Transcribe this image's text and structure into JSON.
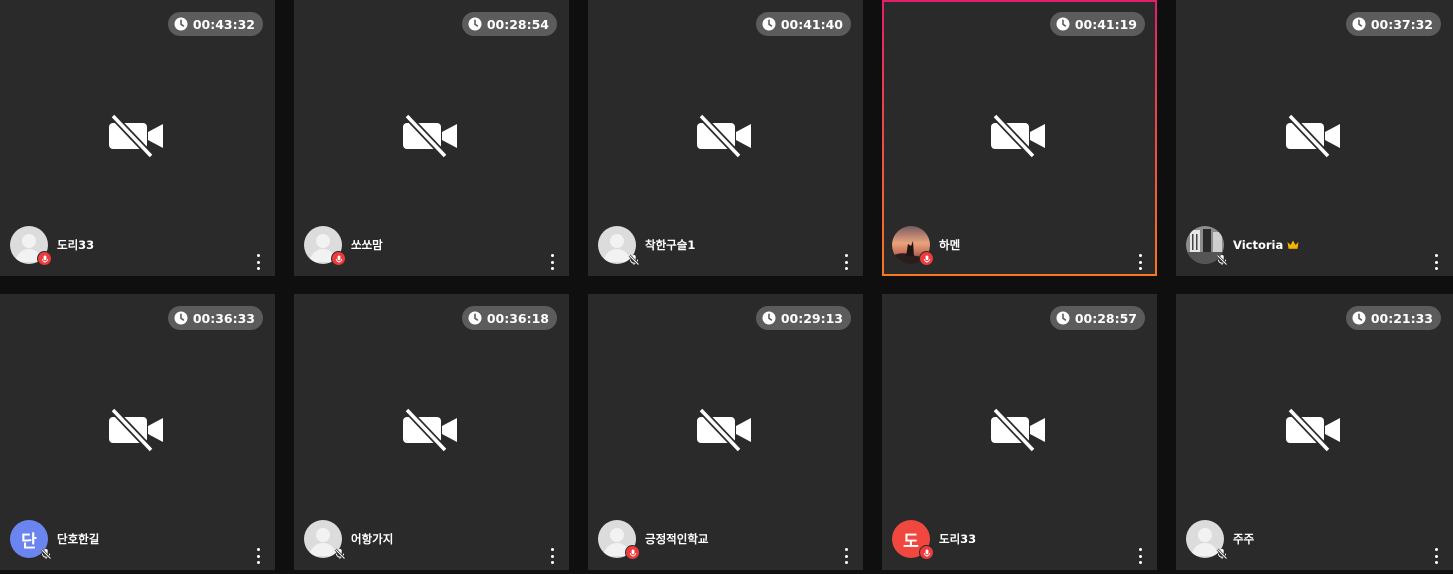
{
  "colors": {
    "page_background": "#0f0f0f",
    "tile_background": "#2a2a2a",
    "timer_background": "#5c5c5c",
    "active_border_start": "#e21f6b",
    "active_border_end": "#f4791f",
    "mic_on_badge": "#ef3b3b"
  },
  "tiles": [
    {
      "timer": "00:43:32",
      "name": "도리33",
      "avatar": "default",
      "mic": "on"
    },
    {
      "timer": "00:28:54",
      "name": "쏘쏘맘",
      "avatar": "default",
      "mic": "on"
    },
    {
      "timer": "00:41:40",
      "name": "착한구슬1",
      "avatar": "default",
      "mic": "off"
    },
    {
      "timer": "00:41:19",
      "name": "하멘",
      "avatar": "photo-sunset",
      "mic": "on",
      "active": true
    },
    {
      "timer": "00:37:32",
      "name": "Victoria",
      "avatar": "photo-room",
      "mic": "off",
      "crown": true
    },
    {
      "timer": "00:36:33",
      "name": "단호한길",
      "avatar": "initial",
      "initial": "단",
      "avatar_color": "#6b85f0",
      "mic": "off"
    },
    {
      "timer": "00:36:18",
      "name": "어항가지",
      "avatar": "default",
      "mic": "off"
    },
    {
      "timer": "00:29:13",
      "name": "긍정적인학교",
      "avatar": "default",
      "mic": "on"
    },
    {
      "timer": "00:28:57",
      "name": "도리33",
      "avatar": "initial",
      "initial": "도",
      "avatar_color": "#f0473f",
      "mic": "on"
    },
    {
      "timer": "00:21:33",
      "name": "주주",
      "avatar": "default",
      "mic": "off"
    }
  ],
  "icons": {
    "timer": "clock-icon",
    "camera": "video-off-icon",
    "menu": "more-vertical-icon",
    "mic_on": "microphone-icon",
    "mic_off": "microphone-muted-icon",
    "crown": "crown-icon"
  }
}
